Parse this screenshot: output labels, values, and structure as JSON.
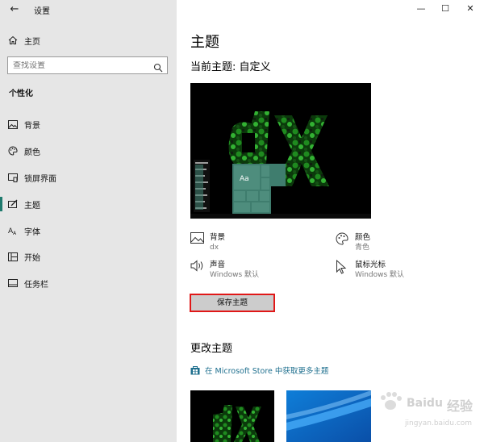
{
  "window": {
    "title": "设置",
    "controls": [
      "—",
      "☐",
      "✕"
    ]
  },
  "sidebar": {
    "home_label": "主页",
    "search_placeholder": "查找设置",
    "section_title": "个性化",
    "items": [
      {
        "label": "背景",
        "icon": "image-icon"
      },
      {
        "label": "颜色",
        "icon": "palette-icon"
      },
      {
        "label": "锁屏界面",
        "icon": "lock-screen-icon"
      },
      {
        "label": "主题",
        "icon": "theme-brush-icon",
        "selected": true
      },
      {
        "label": "字体",
        "icon": "font-icon"
      },
      {
        "label": "开始",
        "icon": "start-menu-icon"
      },
      {
        "label": "任务栏",
        "icon": "taskbar-icon"
      }
    ]
  },
  "main": {
    "title": "主题",
    "current_theme": "当前主题: 自定义",
    "preview_tile_label": "Aa",
    "properties": [
      {
        "title": "背景",
        "subtitle": "dx",
        "icon": "image-icon"
      },
      {
        "title": "颜色",
        "subtitle": "青色",
        "icon": "palette-icon"
      },
      {
        "title": "声音",
        "subtitle": "Windows 默认",
        "icon": "speaker-icon"
      },
      {
        "title": "鼠标光标",
        "subtitle": "Windows 默认",
        "icon": "cursor-icon"
      }
    ],
    "save_button": "保存主题",
    "change_theme_title": "更改主题",
    "store_link": "在 Microsoft Store 中获取更多主题"
  },
  "watermark": {
    "brand": "Baidu",
    "brand_cn": "经验",
    "url": "jingyan.baidu.com"
  },
  "colors": {
    "accent": "#1e7a6d",
    "tile": "#3f7d6e",
    "link": "#1e6f8e",
    "highlight_border": "#e01818"
  }
}
